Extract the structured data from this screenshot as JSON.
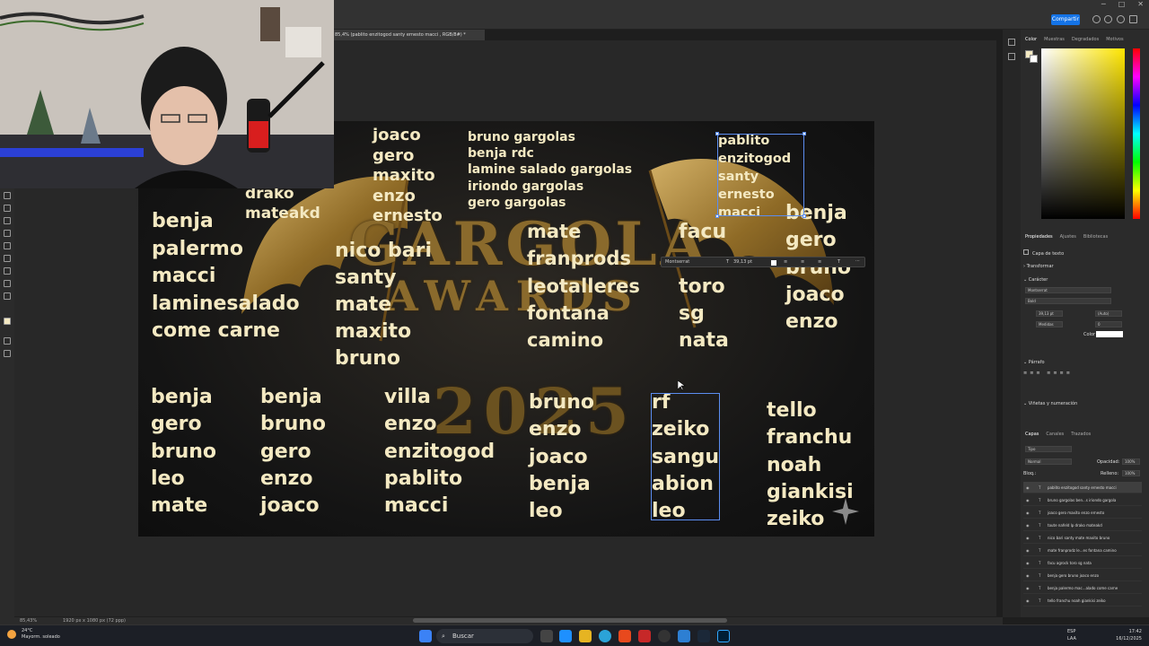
{
  "app": {
    "share_label": "Compartir",
    "window_controls": [
      "─",
      "□",
      "✕"
    ]
  },
  "document": {
    "tab_title": "85,4% (pablito enzitogod santy ernesto macci , RGB/8#) *"
  },
  "artboard": {
    "title_line1": "GARGOLA",
    "title_line2": "AWARDS",
    "year": "2025",
    "columns": [
      {
        "id": "c1",
        "lines": [
          "joaco",
          "gero",
          "maxito",
          "enzo",
          "ernesto"
        ]
      },
      {
        "id": "c2",
        "lines": [
          "bruno gargolas",
          "benja rdc",
          "lamine salado gargolas",
          "iriondo gargolas",
          "gero gargolas"
        ]
      },
      {
        "id": "c3",
        "lines": [
          "pablito",
          "enzitogod",
          "santy",
          "ernesto",
          "macci"
        ]
      },
      {
        "id": "c4",
        "lines": [
          "drako",
          "mateakd"
        ]
      },
      {
        "id": "c5",
        "lines": [
          "benja",
          "palermo",
          "macci",
          "laminesalado",
          "come carne"
        ]
      },
      {
        "id": "c6",
        "lines": [
          "nico bari",
          "santy",
          "mate",
          "maxito",
          "bruno"
        ]
      },
      {
        "id": "c7",
        "lines": [
          "mate",
          "franprods",
          "leotalleres",
          "fontana",
          "camino"
        ]
      },
      {
        "id": "c8",
        "lines": [
          "facu",
          "",
          "toro",
          "sg",
          "nata"
        ]
      },
      {
        "id": "c9",
        "lines": [
          "benja",
          "gero",
          "bruno",
          "joaco",
          "enzo"
        ]
      },
      {
        "id": "c10",
        "lines": [
          "benja",
          "gero",
          "bruno",
          " leo",
          "mate"
        ]
      },
      {
        "id": "c11",
        "lines": [
          "benja",
          "bruno",
          "gero",
          "enzo",
          "joaco"
        ]
      },
      {
        "id": "c12",
        "lines": [
          "villa",
          "enzo",
          "enzitogod",
          "pablito",
          "macci"
        ]
      },
      {
        "id": "c13",
        "lines": [
          "bruno",
          "enzo",
          "joaco",
          "benja",
          "leo"
        ]
      },
      {
        "id": "c14",
        "lines": [
          "rf",
          "zeiko",
          "sangu",
          "abion",
          "leo"
        ]
      },
      {
        "id": "c15",
        "lines": [
          "tello",
          "franchu",
          "noah",
          "giankisi",
          "zeiko"
        ]
      }
    ]
  },
  "context_bar": {
    "font": "Montserrat",
    "size": "39,13 pt"
  },
  "right_panel": {
    "color_tabs": [
      "Color",
      "Muestras",
      "Degradados",
      "Motivos"
    ],
    "props_tabs": [
      "Propiedades",
      "Ajustes",
      "Bibliotecas"
    ],
    "layer_type": "Capa de texto",
    "transform_label": "Transformar",
    "character_label": "Carácter",
    "font_family": "Montserrat",
    "font_style": "Bold",
    "font_size": "39,13 pt",
    "leading": "(Auto)",
    "kerning": "Medidas",
    "tracking": "0",
    "color_label": "Color",
    "paragraph_label": "Párrafo",
    "bullets_label": "Viñetas y numeración",
    "layers_tabs": [
      "Capas",
      "Canales",
      "Trazados"
    ],
    "kind_filter": "Tipo",
    "blend_mode": "Normal",
    "opacity_label": "Opacidad:",
    "opacity": "100%",
    "lock_label": "Bloq.:",
    "fill_label": "Relleno:",
    "fill": "100%",
    "layers": [
      {
        "name": "pablito enzitogod santy ernesto macci",
        "selected": true
      },
      {
        "name": "bruno gargolas ben...s iriondo gargola",
        "selected": false
      },
      {
        "name": "joaco gero maxito enzo ernesto",
        "selected": false
      },
      {
        "name": "toute nafeld lp drako mateakd",
        "selected": false
      },
      {
        "name": "nico bari santy mate maxito bruno",
        "selected": false
      },
      {
        "name": "mate franprodz le...es fontana camino",
        "selected": false
      },
      {
        "name": "facu agrock toro sg nata",
        "selected": false
      },
      {
        "name": "benja gero bruno joaco enzo",
        "selected": false
      },
      {
        "name": "benja palermo mac...alado come carne",
        "selected": false
      },
      {
        "name": "tello franchu noah giankisi zeiko",
        "selected": false
      }
    ]
  },
  "status_bar": {
    "zoom": "85,43%",
    "doc_info": "1920 px x 1080 px (72 ppp)"
  },
  "taskbar": {
    "weather_temp": "24°C",
    "weather_desc": "Mayorm. soleado",
    "search_label": "Buscar",
    "lang_line1": "ESP",
    "lang_line2": "LAA",
    "time": "17:42",
    "date": "16/12/2025"
  }
}
